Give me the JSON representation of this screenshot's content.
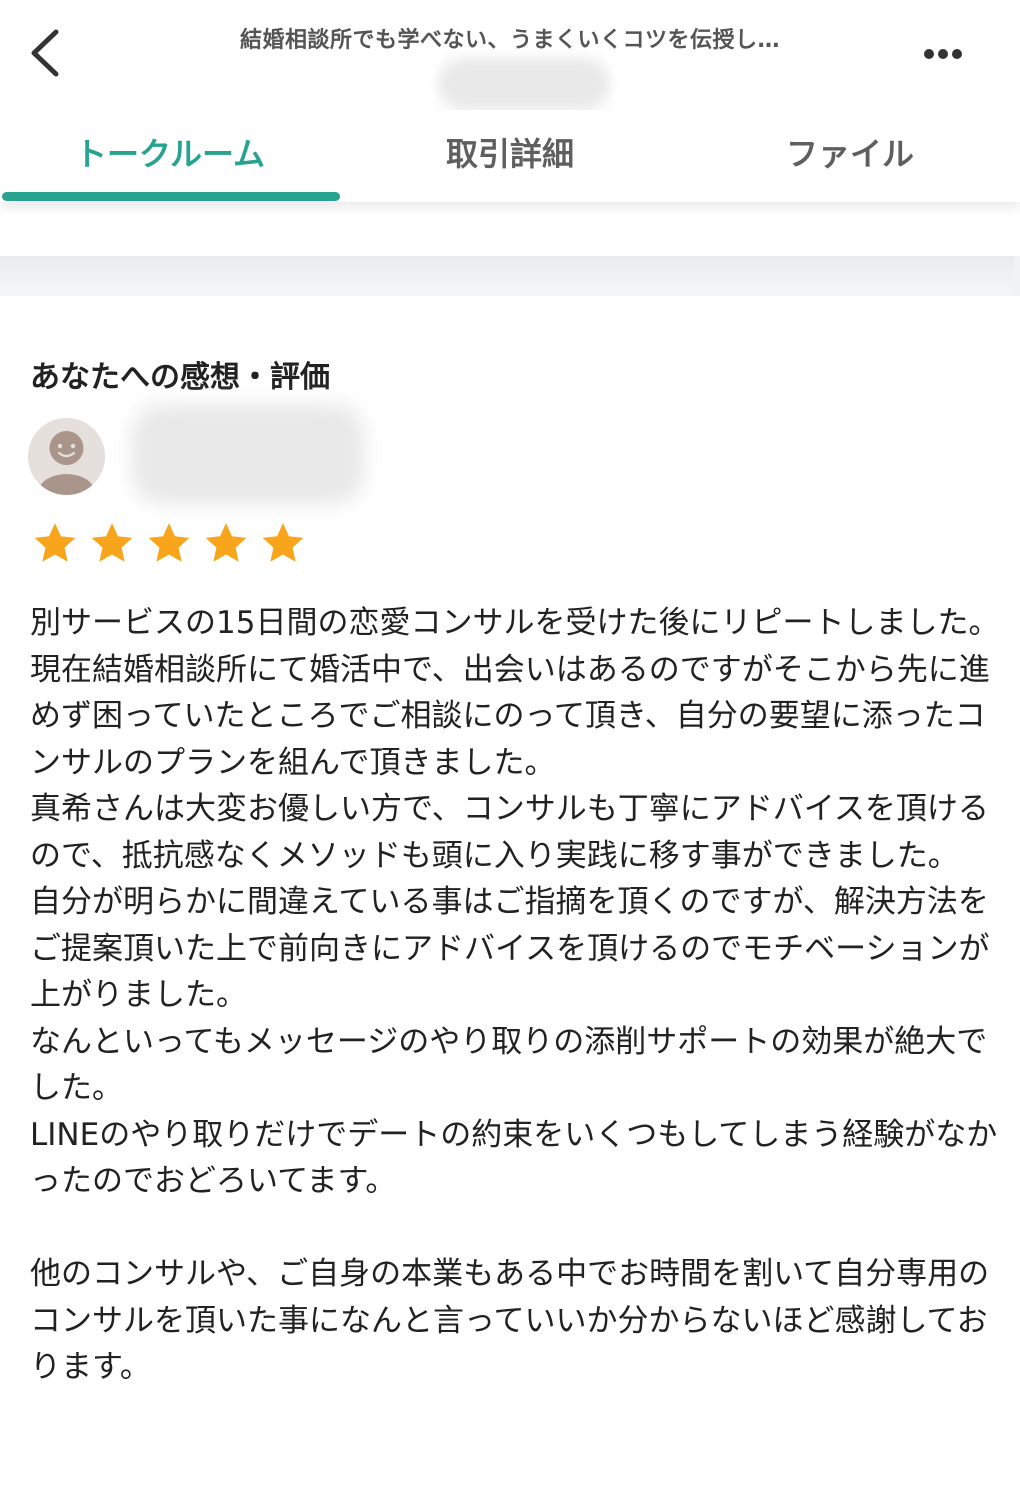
{
  "header": {
    "title": "結婚相談所でも学べない、うまくいくコツを伝授し…"
  },
  "tabs": [
    {
      "label": "トークルーム",
      "active": true
    },
    {
      "label": "取引詳細",
      "active": false
    },
    {
      "label": "ファイル",
      "active": false
    }
  ],
  "review": {
    "section_title": "あなたへの感想・評価",
    "rating": 5,
    "max_rating": 5,
    "paragraphs": [
      "別サービスの15日間の恋愛コンサルを受けた後にリピートしました。",
      "現在結婚相談所にて婚活中で、出会いはあるのですがそこから先に進めず困っていたところでご相談にのって頂き、自分の要望に添ったコンサルのプランを組んで頂きました。",
      "真希さんは大変お優しい方で、コンサルも丁寧にアドバイスを頂けるので、抵抗感なくメソッドも頭に入り実践に移す事ができました。",
      "自分が明らかに間違えている事はご指摘を頂くのですが、解決方法をご提案頂いた上で前向きにアドバイスを頂けるのでモチベーションが上がりました。",
      "なんといってもメッセージのやり取りの添削サポートの効果が絶大でした。",
      "LINEのやり取りだけでデートの約束をいくつもしてしまう経験がなかったのでおどろいてます。",
      "",
      "他のコンサルや、ご自身の本業もある中でお時間を割いて自分専用のコンサルを頂いた事になんと言っていいか分からないほど感謝しております。"
    ]
  },
  "icons": {
    "back": "chevron-left-icon",
    "more": "more-horizontal-icon",
    "avatar": "default-avatar-icon",
    "star": "star-icon"
  },
  "colors": {
    "accent": "#27a38f",
    "star": "#f8a51c",
    "text": "#222222",
    "tab_inactive": "#5f5f5f"
  }
}
